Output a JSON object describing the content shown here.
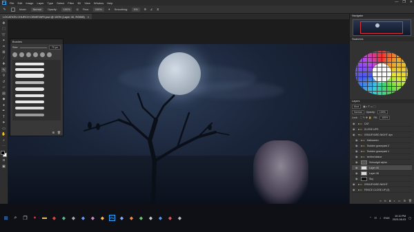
{
  "menu": {
    "items": [
      "File",
      "Edit",
      "Image",
      "Layer",
      "Type",
      "Select",
      "Filter",
      "3D",
      "View",
      "Window",
      "Help"
    ]
  },
  "options_bar": {
    "mode_label": "Mode:",
    "mode_value": "Normal",
    "opacity_label": "Opacity:",
    "opacity_value": "100%",
    "flow_label": "Flow:",
    "flow_value": "100%",
    "smoothing_label": "Smoothing:",
    "smoothing_value": "0%"
  },
  "document_tab": {
    "title": "LOCATION CHURCH CEMETARY.psd @ 100% (Layer 40, RGB/8)",
    "close": "×"
  },
  "brushes_panel": {
    "title": "Brushes",
    "size_label": "Size:",
    "size_value": "70 px"
  },
  "navigator": {
    "title": "Navigator"
  },
  "swatches": {
    "title": "Swatches"
  },
  "layers_panel": {
    "title": "Layers",
    "kind_label": "Kind",
    "blend_value": "Normal",
    "opacity_label": "Opacity:",
    "opacity_value": "100%",
    "lock_label": "Lock:",
    "fill_label": "Fill:",
    "fill_value": "100%",
    "layers": [
      {
        "name": "CAT",
        "type": "folder",
        "selected": false
      },
      {
        "name": "CLOSE UPS",
        "type": "folder",
        "selected": false
      },
      {
        "name": "GRAVEYARD NIGHT dyn",
        "type": "folder",
        "selected": false
      },
      {
        "name": "Halloween",
        "type": "folder",
        "selected": false
      },
      {
        "name": "Sudden graveyard 2",
        "type": "folder",
        "selected": false
      },
      {
        "name": "Sudden graveyard 1",
        "type": "folder",
        "selected": false
      },
      {
        "name": "behind statue",
        "type": "folder",
        "selected": false
      },
      {
        "name": "Schoolgirl alpha",
        "type": "layer",
        "thumb": "gray",
        "selected": false
      },
      {
        "name": "Layer 40",
        "type": "layer",
        "thumb": "white",
        "selected": true
      },
      {
        "name": "Layer 36",
        "type": "layer",
        "thumb": "white",
        "selected": false
      },
      {
        "name": "Sky",
        "type": "layer",
        "thumb": "black",
        "selected": false
      },
      {
        "name": "GRAVEYARD NIGHT",
        "type": "folder",
        "selected": false
      },
      {
        "name": "FENCE CLOSE UP (3)",
        "type": "folder",
        "selected": false
      }
    ]
  },
  "window_controls": [
    "—",
    "❐",
    "✕"
  ],
  "taskbar": {
    "language": "ENG",
    "time": "10:10 PM",
    "date": "2023-08-03",
    "ps_label": "Ps"
  }
}
